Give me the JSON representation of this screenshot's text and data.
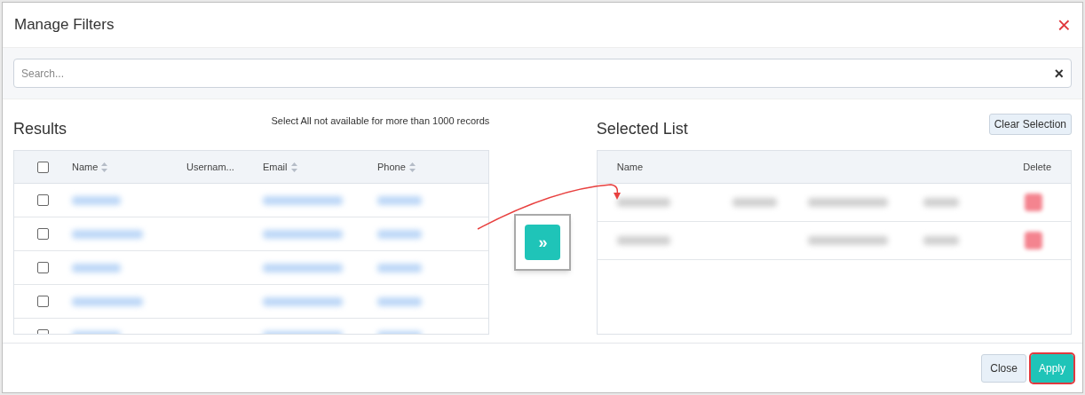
{
  "dialog": {
    "title": "Manage Filters",
    "close_icon": "×"
  },
  "search": {
    "placeholder": "Search...",
    "clear_icon": "×"
  },
  "results": {
    "title": "Results",
    "note": "Select All not available for more than 1000 records",
    "select_all_checked": false,
    "columns": [
      {
        "label": "Name",
        "sortable": true
      },
      {
        "label": "Usernam...",
        "sortable": false
      },
      {
        "label": "Email",
        "sortable": true
      },
      {
        "label": "Phone",
        "sortable": true
      }
    ],
    "rows": [
      {
        "checked": false,
        "kind": "redacted"
      },
      {
        "checked": false,
        "kind": "redacted"
      },
      {
        "checked": false,
        "kind": "redacted"
      },
      {
        "checked": false,
        "kind": "redacted"
      },
      {
        "checked": false,
        "kind": "redacted"
      }
    ]
  },
  "move_button": {
    "icon": "»",
    "highlighted": true
  },
  "selected_list": {
    "title": "Selected List",
    "clear_button": "Clear Selection",
    "columns": [
      {
        "label": "Name"
      },
      {
        "label": "Delete"
      }
    ],
    "rows": [
      {
        "kind": "redacted"
      },
      {
        "kind": "redacted"
      }
    ]
  },
  "footer": {
    "buttons": [
      {
        "label": "Close",
        "kind": "secondary",
        "highlighted": false
      },
      {
        "label": "Apply",
        "kind": "primary",
        "highlighted": true
      }
    ]
  },
  "annotation": {
    "arrow": true
  }
}
